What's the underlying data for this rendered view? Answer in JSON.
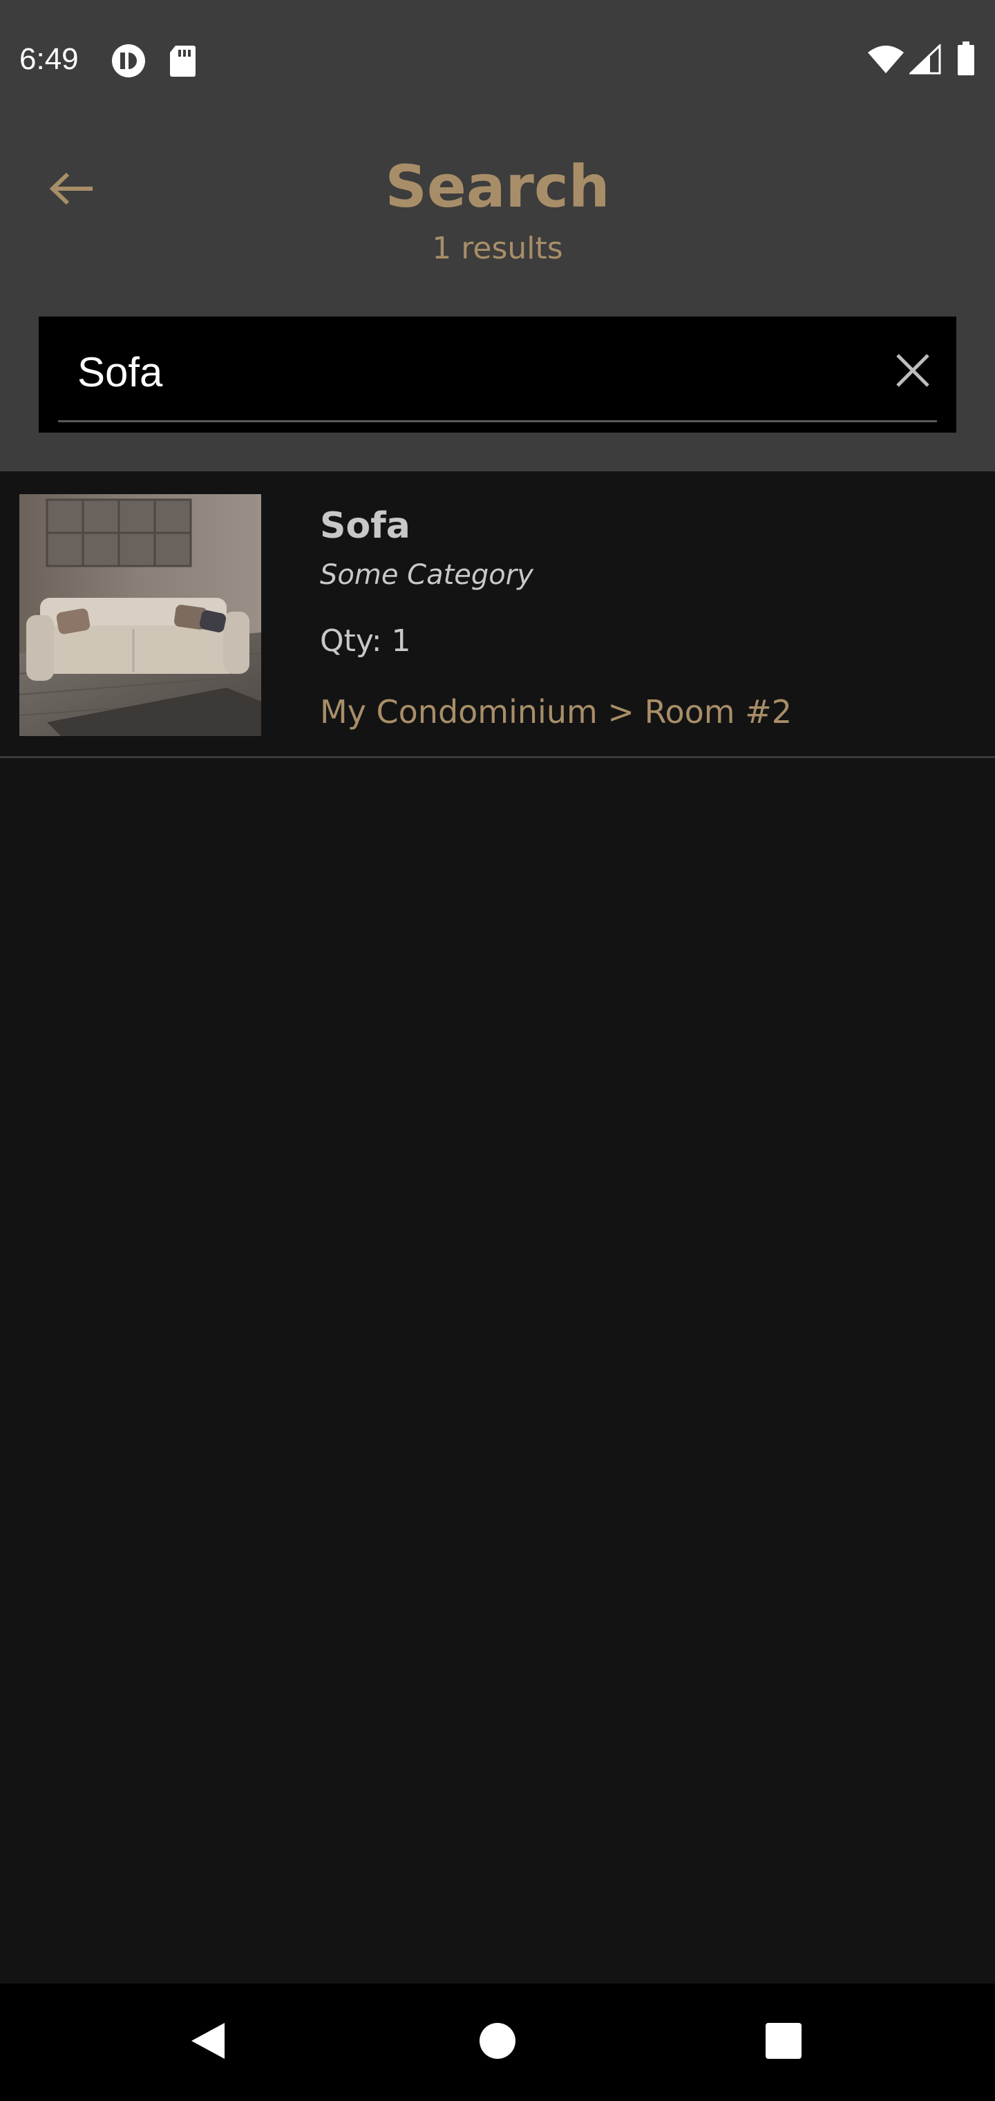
{
  "status_bar": {
    "time": "6:49",
    "left_icons": [
      "circle-badge-icon",
      "sd-card-icon"
    ],
    "right_icons": [
      "wifi-icon",
      "cell-signal-icon",
      "battery-icon"
    ]
  },
  "header": {
    "title": "Search",
    "results_count": "1 results",
    "back_icon": "arrow-left-icon"
  },
  "search": {
    "value": "Sofa",
    "placeholder": "",
    "clear_icon": "close-icon"
  },
  "results": [
    {
      "name": "Sofa",
      "category": "Some Category",
      "qty": "Qty: 1",
      "location": "My Condominium > Room #2",
      "thumbnail": "sofa-photo"
    }
  ],
  "nav_bar": {
    "buttons": [
      "back-triangle-icon",
      "home-circle-icon",
      "recents-square-icon"
    ]
  },
  "colors": {
    "accent": "#a88e68",
    "header_bg": "#3d3d3d",
    "page_bg": "#131313",
    "search_bg": "#000000",
    "text_light": "#c8c8c8"
  }
}
